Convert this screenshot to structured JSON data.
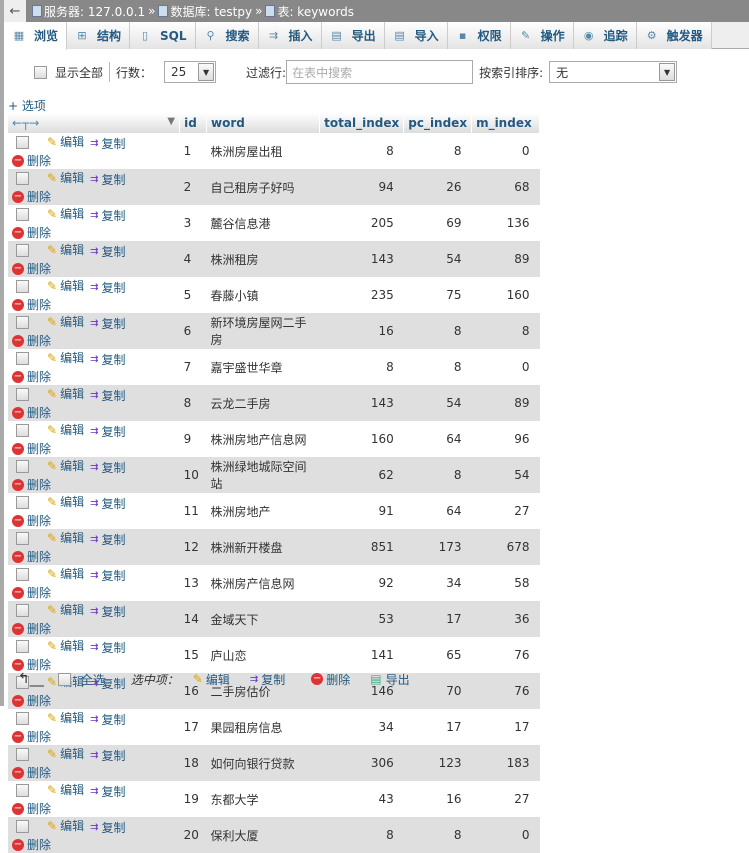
{
  "breadcrumb": {
    "server": "服务器: 127.0.0.1",
    "database": "数据库: testpy",
    "table": "表: keywords",
    "separator": "»"
  },
  "tabs": [
    {
      "label": "浏览",
      "icon": "browse-icon"
    },
    {
      "label": "结构",
      "icon": "structure-icon"
    },
    {
      "label": "SQL",
      "icon": "sql-icon"
    },
    {
      "label": "搜索",
      "icon": "search-icon"
    },
    {
      "label": "插入",
      "icon": "insert-icon"
    },
    {
      "label": "导出",
      "icon": "export-icon"
    },
    {
      "label": "导入",
      "icon": "import-icon"
    },
    {
      "label": "权限",
      "icon": "privileges-icon"
    },
    {
      "label": "操作",
      "icon": "wrench-icon"
    },
    {
      "label": "追踪",
      "icon": "eye-icon"
    },
    {
      "label": "触发器",
      "icon": "triggers-icon"
    }
  ],
  "toolbar": {
    "show_all": "显示全部",
    "rows_label": "行数：",
    "rows_value": "25",
    "filter_label": "过滤行:",
    "filter_placeholder": "在表中搜索",
    "sort_label": "按索引排序:",
    "sort_value": "无"
  },
  "options_link": "+ 选项",
  "columns": [
    "id",
    "word",
    "total_index",
    "pc_index",
    "m_index"
  ],
  "actions": {
    "edit": "编辑",
    "copy": "复制",
    "delete": "删除"
  },
  "rows": [
    [
      "1",
      "株洲房屋出租",
      "8",
      "8",
      "0"
    ],
    [
      "2",
      "自己租房子好吗",
      "94",
      "26",
      "68"
    ],
    [
      "3",
      "麓谷信息港",
      "205",
      "69",
      "136"
    ],
    [
      "4",
      "株洲租房",
      "143",
      "54",
      "89"
    ],
    [
      "5",
      "春藤小镇",
      "235",
      "75",
      "160"
    ],
    [
      "6",
      "新环境房屋网二手房",
      "16",
      "8",
      "8"
    ],
    [
      "7",
      "嘉宇盛世华章",
      "8",
      "8",
      "0"
    ],
    [
      "8",
      "云龙二手房",
      "143",
      "54",
      "89"
    ],
    [
      "9",
      "株洲房地产信息网",
      "160",
      "64",
      "96"
    ],
    [
      "10",
      "株洲绿地城际空间站",
      "62",
      "8",
      "54"
    ],
    [
      "11",
      "株洲房地产",
      "91",
      "64",
      "27"
    ],
    [
      "12",
      "株洲新开楼盘",
      "851",
      "173",
      "678"
    ],
    [
      "13",
      "株洲房产信息网",
      "92",
      "34",
      "58"
    ],
    [
      "14",
      "金域天下",
      "53",
      "17",
      "36"
    ],
    [
      "15",
      "庐山恋",
      "141",
      "65",
      "76"
    ],
    [
      "16",
      "二手房估价",
      "146",
      "70",
      "76"
    ],
    [
      "17",
      "果园租房信息",
      "34",
      "17",
      "17"
    ],
    [
      "18",
      "如何向银行贷款",
      "306",
      "123",
      "183"
    ],
    [
      "19",
      "东都大学",
      "43",
      "16",
      "27"
    ],
    [
      "20",
      "保利大厦",
      "8",
      "8",
      "0"
    ]
  ],
  "footer": {
    "select_all": "全选",
    "with_selected": "选中项：",
    "edit": "编辑",
    "copy": "复制",
    "delete": "删除",
    "export": "导出"
  }
}
